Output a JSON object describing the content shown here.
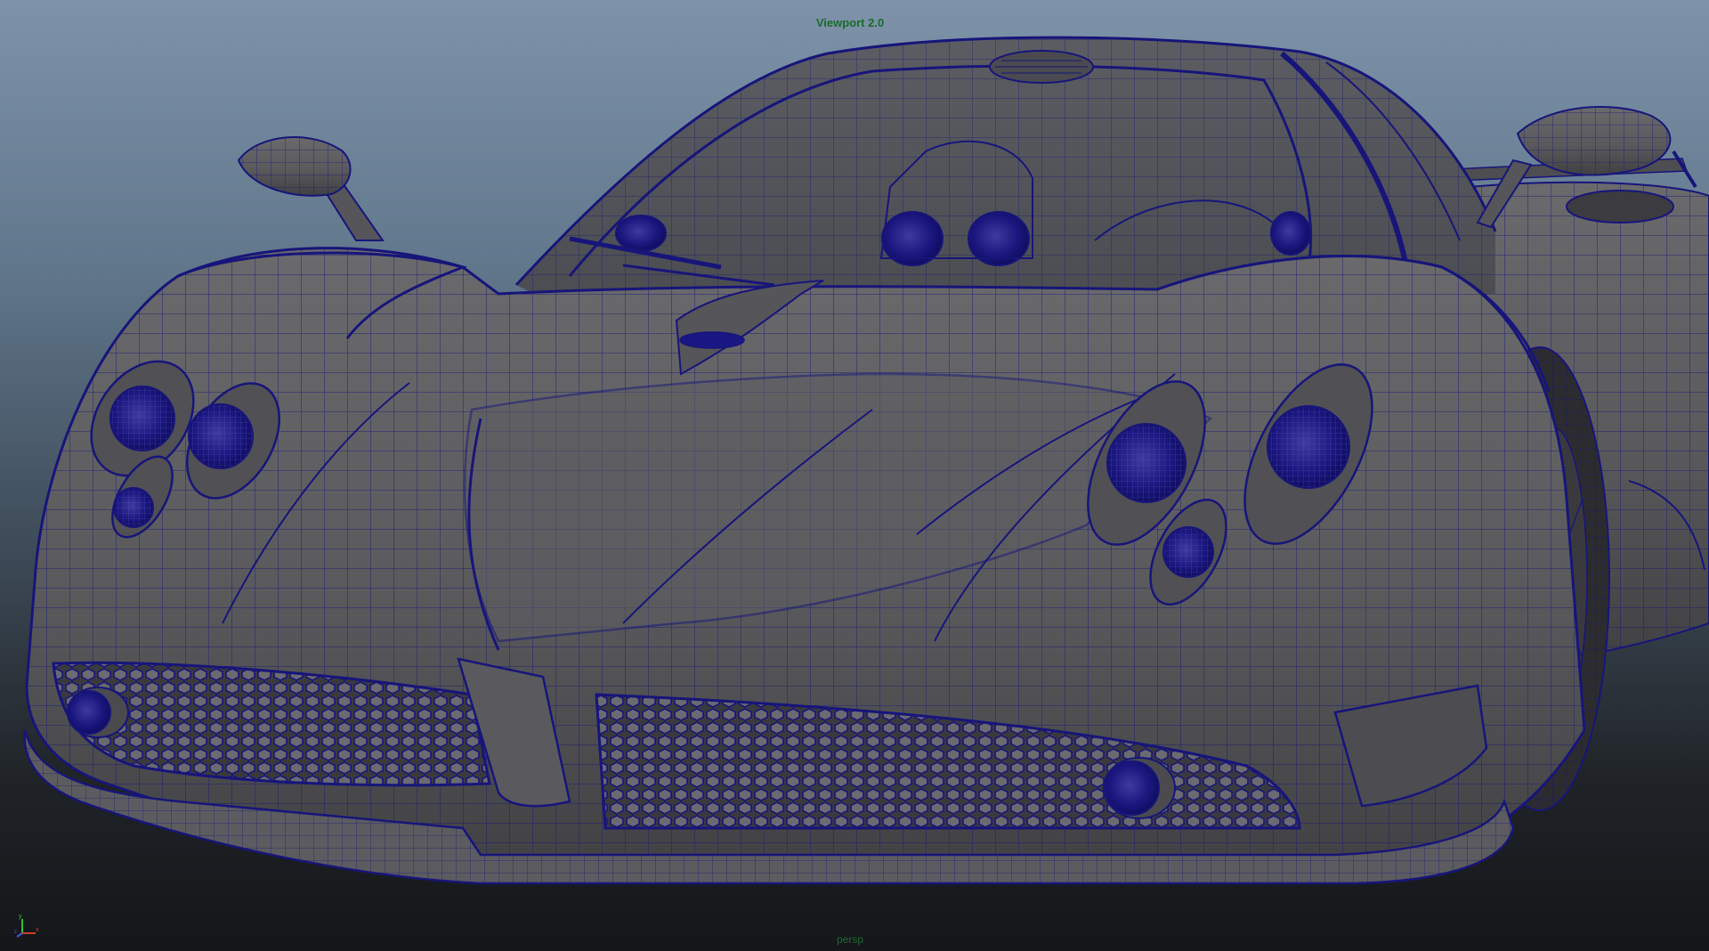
{
  "viewport": {
    "title": "Viewport 2.0",
    "camera": "persp"
  },
  "axis_gizmo": {
    "icon": "axis-gizmo-icon",
    "labels": [
      "y",
      "x",
      "z"
    ]
  },
  "colors": {
    "background_top": "#7e93a9",
    "background_bottom": "#141619",
    "shaded_surface": "#5b5b5e",
    "wireframe": "#17157a",
    "hud_text": "#1a6b2d"
  },
  "object": {
    "name": "sports-car-model",
    "display_mode": "wireframe-on-shaded"
  }
}
